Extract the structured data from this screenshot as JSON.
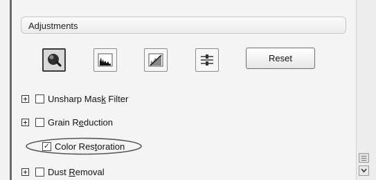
{
  "adjustments": {
    "title": "Adjustments",
    "tools": [
      {
        "icon": "auto-exposure-icon"
      },
      {
        "icon": "histogram-icon"
      },
      {
        "icon": "tone-curve-icon"
      },
      {
        "icon": "image-adjustment-icon"
      }
    ],
    "reset_label": "Reset"
  },
  "options": [
    {
      "pre": "Unsharp Mas",
      "mnemonic": "k",
      "post": " Filter",
      "checked": false,
      "expander": "+"
    },
    {
      "pre": "Grain R",
      "mnemonic": "e",
      "post": "duction",
      "checked": false,
      "expander": "+"
    },
    {
      "pre": "Color Res",
      "mnemonic": "t",
      "post": "oration",
      "checked": true,
      "expander": ""
    },
    {
      "pre": "Dust ",
      "mnemonic": "R",
      "post": "emoval",
      "checked": false,
      "expander": "+"
    }
  ],
  "check_glyph": "✓"
}
